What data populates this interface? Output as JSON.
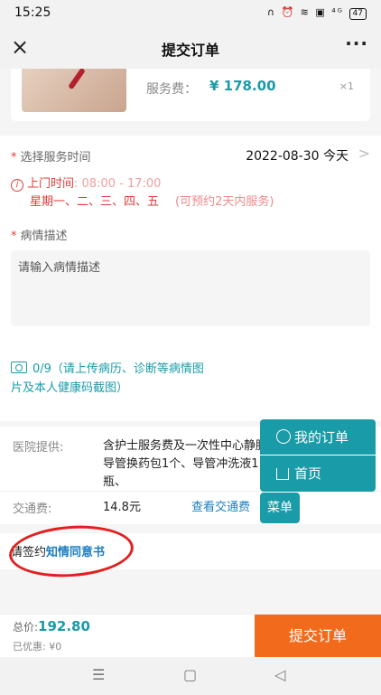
{
  "status": {
    "time": "15:25",
    "icons": "∩ ⏰ ≋ ▣ ⁴ᴳ",
    "battery": "47"
  },
  "nav": {
    "close": "×",
    "title": "提交订单",
    "more": "···"
  },
  "service": {
    "fee_label": "服务费：",
    "fee_value": "¥ 178.00",
    "qty": "×1"
  },
  "time_section": {
    "label": "选择服务时间",
    "date": "2022-08-30 今天",
    "visit_label": "上门时间",
    "hours": ": 08:00 - 17:00",
    "days": "星期一、二、三、四、五",
    "note": "(可预约2天内服务)"
  },
  "desc_section": {
    "label": "病情描述",
    "placeholder": "请输入病情描述"
  },
  "upload": {
    "text": "0/9（请上传病历、诊断等病情图片及本人健康码截图）"
  },
  "hospital": {
    "label": "医院提供:",
    "value": "含护士服务费及一次性中心静脉导管换药包1个、导管冲洗液1瓶、"
  },
  "transport": {
    "label": "交通费:",
    "value": "14.8元",
    "link": "查看交通费"
  },
  "consent": {
    "prefix": "请签约",
    "link": "知情同意书"
  },
  "fab": {
    "orders": "我的订单",
    "home": "首页",
    "menu": "菜单"
  },
  "footer": {
    "total_label": "总价:",
    "total_value": "192.80",
    "discount": "已优惠: ¥0",
    "submit": "提交订单"
  },
  "colors": {
    "accent": "#1a9ba8",
    "submit": "#f26b1d",
    "warning": "#e23c3c"
  }
}
